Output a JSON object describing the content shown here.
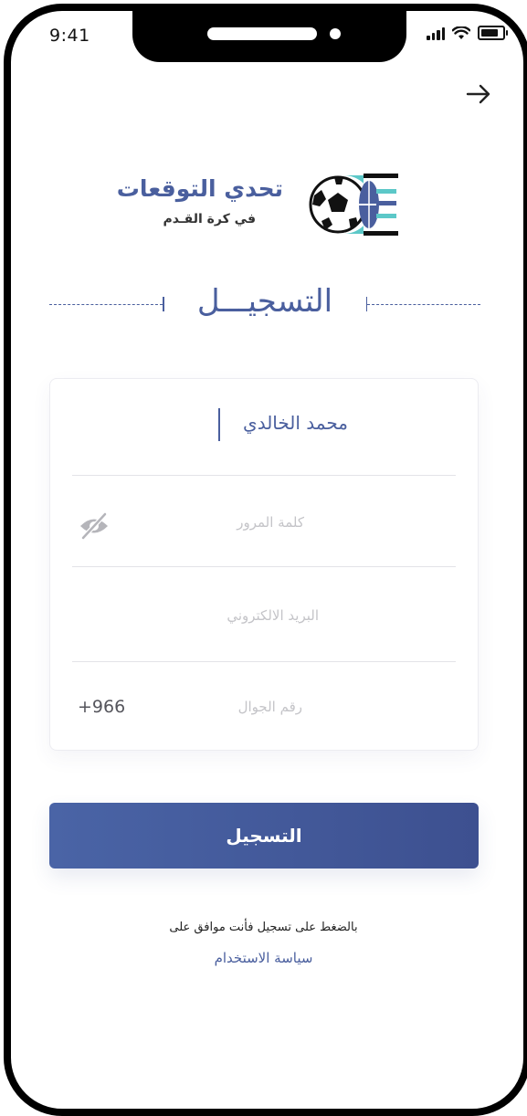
{
  "status_bar": {
    "time": "9:41",
    "icons": [
      "signal-icon",
      "wifi-icon",
      "battery-icon"
    ]
  },
  "header": {
    "back_icon": "arrow-right-icon"
  },
  "logo": {
    "title": "تحدي التوقعات",
    "subtitle": "في كرة القـدم"
  },
  "page": {
    "title": "التسجيـــل"
  },
  "form": {
    "name_value": "محمد الخالدي",
    "password_placeholder": "كلمة المرور",
    "password_toggle_icon": "eye-off-icon",
    "email_placeholder": "البريد الالكتروني",
    "phone_placeholder": "رقم الجوال",
    "country_code": "+966"
  },
  "actions": {
    "register_label": "التسجيل"
  },
  "terms": {
    "text": "بالضغط على تسجيل فأنت موافق على",
    "link": "سياسة الاستخدام"
  },
  "colors": {
    "primary": "#4a5f9e",
    "button_start": "#4a64a6",
    "button_end": "#3d5090",
    "placeholder": "#c4c4c8",
    "teal": "#5cc8c8"
  }
}
